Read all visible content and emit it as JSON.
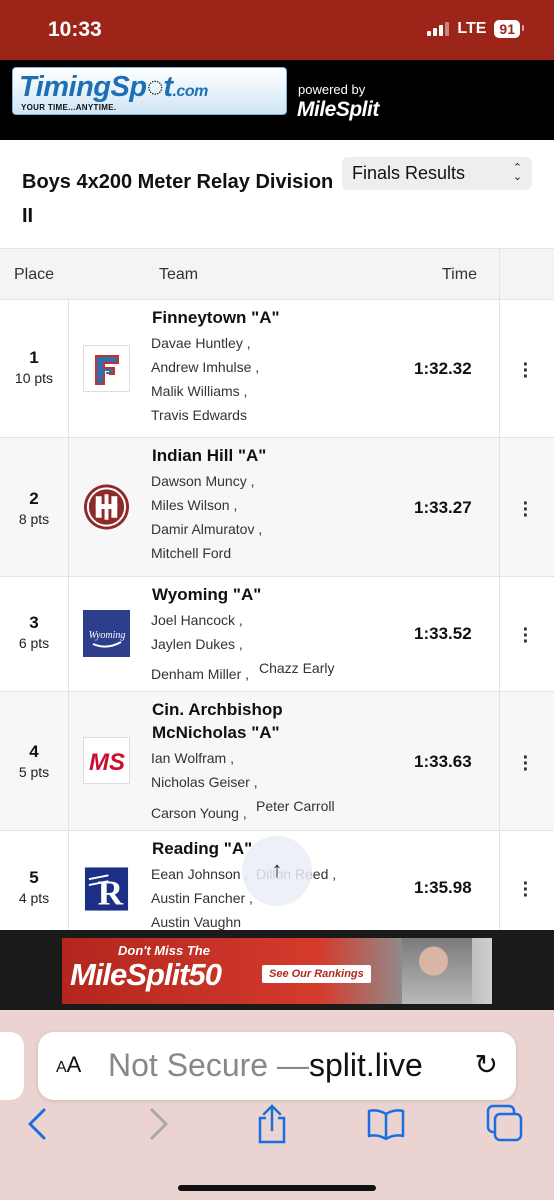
{
  "status_bar": {
    "time": "10:33",
    "network": "LTE",
    "battery": "91"
  },
  "header": {
    "logo_text": "TimingSp",
    "logo_text_end": "t",
    "logo_domain": ".com",
    "logo_tagline": "YOUR TIME...ANYTIME.",
    "powered_by": "powered by",
    "powered_brand": "MileSplit"
  },
  "event": {
    "title": "Boys 4x200 Meter Relay Division II",
    "round_select": "Finals Results"
  },
  "table": {
    "headers": {
      "place": "Place",
      "team": "Team",
      "time": "Time"
    },
    "rows": [
      {
        "place": "1",
        "points": "10 pts",
        "team": "Finneytown \"A\"",
        "time": "1:32.32",
        "athletes": [
          "Davae Huntley ,",
          "Andrew Imhulse ,",
          "Malik Williams ,",
          "Travis Edwards"
        ]
      },
      {
        "place": "2",
        "points": "8 pts",
        "team": "Indian Hill \"A\"",
        "time": "1:33.27",
        "athletes": [
          "Dawson Muncy ,",
          "Miles Wilson ,",
          "Damir Almuratov ,",
          "Mitchell Ford"
        ]
      },
      {
        "place": "3",
        "points": "6 pts",
        "team": "Wyoming \"A\"",
        "time": "1:33.52",
        "athletes": [
          "Joel Hancock ,",
          "Jaylen Dukes ,",
          "Denham Miller ,",
          "Chazz Early"
        ]
      },
      {
        "place": "4",
        "points": "5 pts",
        "team_line1": "Cin. Archbishop",
        "team_line2": "McNicholas \"A\"",
        "time": "1:33.63",
        "athletes": [
          "Ian Wolfram ,",
          "Nicholas Geiser ,",
          "Carson Young ,",
          "Peter Carroll"
        ]
      },
      {
        "place": "5",
        "points": "4 pts",
        "team": "Reading \"A\"",
        "time": "1:35.98",
        "athletes": [
          "Eean Johnson ,",
          "Dillon Reed ,",
          "Austin Fancher ,",
          "Austin Vaughn"
        ]
      }
    ]
  },
  "logos": {
    "finneytown": "F",
    "indian_hill": "IH",
    "wyoming": "Wyoming",
    "mcnicholas": "MS",
    "reading": "R"
  },
  "ad": {
    "line1": "Don't Miss The",
    "line2": "MileSplit50",
    "button": "See Our Rankings"
  },
  "browser": {
    "text_size": "AA",
    "url_not_secure": "Not Secure —",
    "url_domain": "split.live"
  },
  "icons": {
    "more": "⋮",
    "scroll_top": "↑",
    "reload": "↻",
    "select_up": "⌃",
    "select_down": "⌄"
  },
  "colors": {
    "status_bar": "#9c2419",
    "browser_bar": "#ead3d0",
    "link_blue": "#1a6fe0"
  }
}
